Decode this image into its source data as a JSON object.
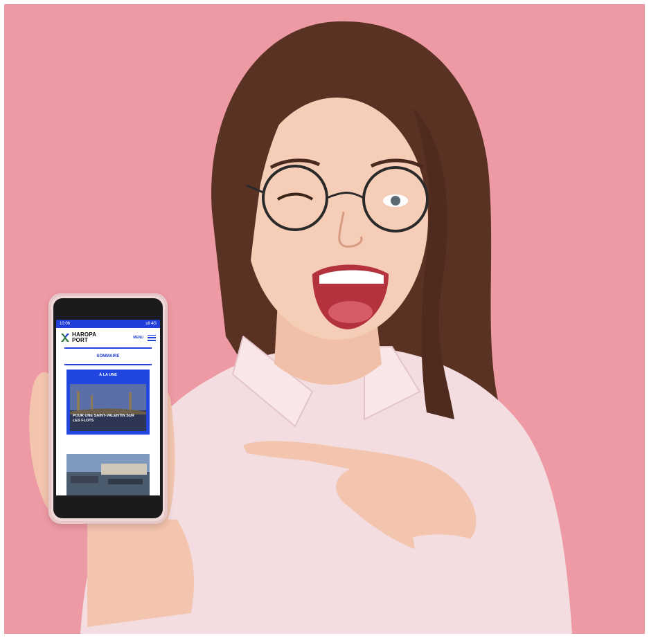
{
  "phone": {
    "status_time": "10:06",
    "status_icons": "ull 4G",
    "logo_line1": "HAROPA",
    "logo_line2": "PORT",
    "menu_label": "MENU",
    "section_title": "SOMMAIRE",
    "featured_tag": "À LA UNE",
    "featured_title": "POUR UNE SAINT-VALENTIN SUR LES FLOTS"
  },
  "colors": {
    "background": "#ee9aa4",
    "brand_blue": "#1f3fd8",
    "shirt": "#f4dde0",
    "hair": "#5a3224"
  }
}
